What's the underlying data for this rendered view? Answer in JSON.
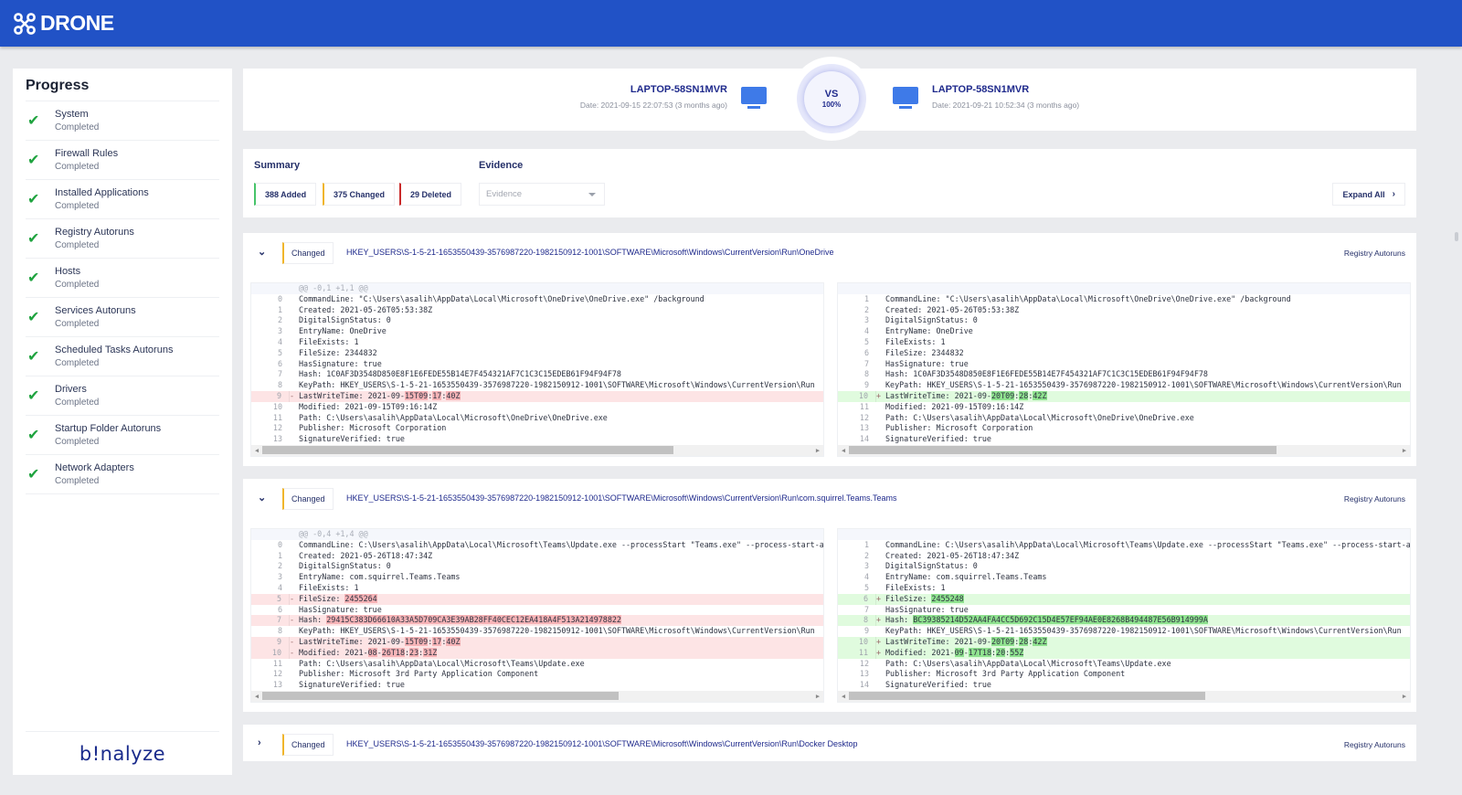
{
  "app": {
    "title": "DRONE",
    "brand_color": "#2152c6",
    "footer_brand": "b!nalyze"
  },
  "sidebar": {
    "title": "Progress",
    "items": [
      {
        "name": "System",
        "status": "Completed"
      },
      {
        "name": "Firewall Rules",
        "status": "Completed"
      },
      {
        "name": "Installed Applications",
        "status": "Completed"
      },
      {
        "name": "Registry Autoruns",
        "status": "Completed"
      },
      {
        "name": "Hosts",
        "status": "Completed"
      },
      {
        "name": "Services Autoruns",
        "status": "Completed"
      },
      {
        "name": "Scheduled Tasks Autoruns",
        "status": "Completed"
      },
      {
        "name": "Drivers",
        "status": "Completed"
      },
      {
        "name": "Startup Folder Autoruns",
        "status": "Completed"
      },
      {
        "name": "Network Adapters",
        "status": "Completed"
      }
    ]
  },
  "compare": {
    "left": {
      "host": "LAPTOP-58SN1MVR",
      "date": "Date: 2021-09-15 22:07:53 (3 months ago)"
    },
    "right": {
      "host": "LAPTOP-58SN1MVR",
      "date": "Date: 2021-09-21 10:52:34 (3 months ago)"
    },
    "vs_label": "VS",
    "similarity": "100%"
  },
  "summary": {
    "title": "Summary",
    "added": "388 Added",
    "changed": "375 Changed",
    "deleted": "29 Deleted",
    "evidence_title": "Evidence",
    "evidence_placeholder": "Evidence",
    "expand_all": "Expand All",
    "colors": {
      "added": "#47c46a",
      "changed": "#f0b52b",
      "deleted": "#c92a2a"
    }
  },
  "entries": [
    {
      "status": "Changed",
      "path": "HKEY_USERS\\S-1-5-21-1653550439-3576987220-1982150912-1001\\SOFTWARE\\Microsoft\\Windows\\CurrentVersion\\Run\\OneDrive",
      "category": "Registry Autoruns",
      "expanded": true,
      "left": [
        {
          "type": "hunk",
          "num": "",
          "text": "@@ -0,1 +1,1 @@"
        },
        {
          "type": "ctx",
          "num": "0",
          "text": "CommandLine: \"C:\\Users\\asalih\\AppData\\Local\\Microsoft\\OneDrive\\OneDrive.exe\" /background"
        },
        {
          "type": "ctx",
          "num": "1",
          "text": "Created: 2021-05-26T05:53:38Z"
        },
        {
          "type": "ctx",
          "num": "2",
          "text": "DigitalSignStatus: 0"
        },
        {
          "type": "ctx",
          "num": "3",
          "text": "EntryName: OneDrive"
        },
        {
          "type": "ctx",
          "num": "4",
          "text": "FileExists: 1"
        },
        {
          "type": "ctx",
          "num": "5",
          "text": "FileSize: 2344832"
        },
        {
          "type": "ctx",
          "num": "6",
          "text": "HasSignature: true"
        },
        {
          "type": "ctx",
          "num": "7",
          "text": "Hash: 1C0AF3D3548D850E8F1E6FEDE55B14E7F454321AF7C1C3C15EDEB61F94F94F78"
        },
        {
          "type": "ctx",
          "num": "8",
          "text": "KeyPath: HKEY_USERS\\S-1-5-21-1653550439-3576987220-1982150912-1001\\SOFTWARE\\Microsoft\\Windows\\CurrentVersion\\Run"
        },
        {
          "type": "del",
          "num": "9",
          "parts": [
            "LastWriteTime: 2021-09-",
            {
              "h": "15T09"
            },
            ":",
            {
              "h": "17"
            },
            ":",
            {
              "h": "40Z"
            }
          ]
        },
        {
          "type": "ctx",
          "num": "10",
          "text": "Modified: 2021-09-15T09:16:14Z"
        },
        {
          "type": "ctx",
          "num": "11",
          "text": "Path: C:\\Users\\asalih\\AppData\\Local\\Microsoft\\OneDrive\\OneDrive.exe"
        },
        {
          "type": "ctx",
          "num": "12",
          "text": "Publisher: Microsoft Corporation"
        },
        {
          "type": "ctx",
          "num": "13",
          "text": "SignatureVerified: true"
        }
      ],
      "right": [
        {
          "type": "hunk",
          "num": "",
          "text": ""
        },
        {
          "type": "ctx",
          "num": "1",
          "text": "CommandLine: \"C:\\Users\\asalih\\AppData\\Local\\Microsoft\\OneDrive\\OneDrive.exe\" /background"
        },
        {
          "type": "ctx",
          "num": "2",
          "text": "Created: 2021-05-26T05:53:38Z"
        },
        {
          "type": "ctx",
          "num": "3",
          "text": "DigitalSignStatus: 0"
        },
        {
          "type": "ctx",
          "num": "4",
          "text": "EntryName: OneDrive"
        },
        {
          "type": "ctx",
          "num": "5",
          "text": "FileExists: 1"
        },
        {
          "type": "ctx",
          "num": "6",
          "text": "FileSize: 2344832"
        },
        {
          "type": "ctx",
          "num": "7",
          "text": "HasSignature: true"
        },
        {
          "type": "ctx",
          "num": "8",
          "text": "Hash: 1C0AF3D3548D850E8F1E6FEDE55B14E7F454321AF7C1C3C15EDEB61F94F94F78"
        },
        {
          "type": "ctx",
          "num": "9",
          "text": "KeyPath: HKEY_USERS\\S-1-5-21-1653550439-3576987220-1982150912-1001\\SOFTWARE\\Microsoft\\Windows\\CurrentVersion\\Run"
        },
        {
          "type": "add",
          "num": "10",
          "parts": [
            "LastWriteTime: 2021-09-",
            {
              "h": "20T09"
            },
            ":",
            {
              "h": "28"
            },
            ":",
            {
              "h": "42Z"
            }
          ]
        },
        {
          "type": "ctx",
          "num": "11",
          "text": "Modified: 2021-09-15T09:16:14Z"
        },
        {
          "type": "ctx",
          "num": "12",
          "text": "Path: C:\\Users\\asalih\\AppData\\Local\\Microsoft\\OneDrive\\OneDrive.exe"
        },
        {
          "type": "ctx",
          "num": "13",
          "text": "Publisher: Microsoft Corporation"
        },
        {
          "type": "ctx",
          "num": "14",
          "text": "SignatureVerified: true"
        }
      ]
    },
    {
      "status": "Changed",
      "path": "HKEY_USERS\\S-1-5-21-1653550439-3576987220-1982150912-1001\\SOFTWARE\\Microsoft\\Windows\\CurrentVersion\\Run\\com.squirrel.Teams.Teams",
      "category": "Registry Autoruns",
      "expanded": true,
      "left": [
        {
          "type": "hunk",
          "num": "",
          "text": "@@ -0,4 +1,4 @@"
        },
        {
          "type": "ctx",
          "num": "0",
          "text": "CommandLine: C:\\Users\\asalih\\AppData\\Local\\Microsoft\\Teams\\Update.exe --processStart \"Teams.exe\" --process-start-args \"--system-initiated\""
        },
        {
          "type": "ctx",
          "num": "1",
          "text": "Created: 2021-05-26T18:47:34Z"
        },
        {
          "type": "ctx",
          "num": "2",
          "text": "DigitalSignStatus: 0"
        },
        {
          "type": "ctx",
          "num": "3",
          "text": "EntryName: com.squirrel.Teams.Teams"
        },
        {
          "type": "ctx",
          "num": "4",
          "text": "FileExists: 1"
        },
        {
          "type": "del",
          "num": "5",
          "parts": [
            "FileSize: ",
            {
              "h": "2455264"
            }
          ]
        },
        {
          "type": "ctx",
          "num": "6",
          "text": "HasSignature: true"
        },
        {
          "type": "del",
          "num": "7",
          "parts": [
            "Hash: ",
            {
              "h": "29415C383D66610A33A5D709CA3E39AB28FF40CEC12EA418A4F513A214978822"
            }
          ]
        },
        {
          "type": "ctx",
          "num": "8",
          "text": "KeyPath: HKEY_USERS\\S-1-5-21-1653550439-3576987220-1982150912-1001\\SOFTWARE\\Microsoft\\Windows\\CurrentVersion\\Run"
        },
        {
          "type": "del",
          "num": "9",
          "parts": [
            "LastWriteTime: 2021-09-",
            {
              "h": "15T09"
            },
            ":",
            {
              "h": "17"
            },
            ":",
            {
              "h": "40Z"
            }
          ]
        },
        {
          "type": "del",
          "num": "10",
          "parts": [
            "Modified: 2021-",
            {
              "h": "08"
            },
            "-",
            {
              "h": "26T18"
            },
            ":",
            {
              "h": "23"
            },
            ":",
            {
              "h": "31Z"
            }
          ]
        },
        {
          "type": "ctx",
          "num": "11",
          "text": "Path: C:\\Users\\asalih\\AppData\\Local\\Microsoft\\Teams\\Update.exe"
        },
        {
          "type": "ctx",
          "num": "12",
          "text": "Publisher: Microsoft 3rd Party Application Component"
        },
        {
          "type": "ctx",
          "num": "13",
          "text": "SignatureVerified: true"
        }
      ],
      "right": [
        {
          "type": "hunk",
          "num": "",
          "text": ""
        },
        {
          "type": "ctx",
          "num": "1",
          "text": "CommandLine: C:\\Users\\asalih\\AppData\\Local\\Microsoft\\Teams\\Update.exe --processStart \"Teams.exe\" --process-start-args \"--system-initiated\""
        },
        {
          "type": "ctx",
          "num": "2",
          "text": "Created: 2021-05-26T18:47:34Z"
        },
        {
          "type": "ctx",
          "num": "3",
          "text": "DigitalSignStatus: 0"
        },
        {
          "type": "ctx",
          "num": "4",
          "text": "EntryName: com.squirrel.Teams.Teams"
        },
        {
          "type": "ctx",
          "num": "5",
          "text": "FileExists: 1"
        },
        {
          "type": "add",
          "num": "6",
          "parts": [
            "FileSize: ",
            {
              "h": "2455248"
            }
          ]
        },
        {
          "type": "ctx",
          "num": "7",
          "text": "HasSignature: true"
        },
        {
          "type": "add",
          "num": "8",
          "parts": [
            "Hash: ",
            {
              "h": "BC39385214D52AA4FA4CC5D692C15D4E57EF94AE0E8268B494487E56B914999A"
            }
          ]
        },
        {
          "type": "ctx",
          "num": "9",
          "text": "KeyPath: HKEY_USERS\\S-1-5-21-1653550439-3576987220-1982150912-1001\\SOFTWARE\\Microsoft\\Windows\\CurrentVersion\\Run"
        },
        {
          "type": "add",
          "num": "10",
          "parts": [
            "LastWriteTime: 2021-09-",
            {
              "h": "20T09"
            },
            ":",
            {
              "h": "28"
            },
            ":",
            {
              "h": "42Z"
            }
          ]
        },
        {
          "type": "add",
          "num": "11",
          "parts": [
            "Modified: 2021-",
            {
              "h": "09"
            },
            "-",
            {
              "h": "17T18"
            },
            ":",
            {
              "h": "20"
            },
            ":",
            {
              "h": "55Z"
            }
          ]
        },
        {
          "type": "ctx",
          "num": "12",
          "text": "Path: C:\\Users\\asalih\\AppData\\Local\\Microsoft\\Teams\\Update.exe"
        },
        {
          "type": "ctx",
          "num": "13",
          "text": "Publisher: Microsoft 3rd Party Application Component"
        },
        {
          "type": "ctx",
          "num": "14",
          "text": "SignatureVerified: true"
        }
      ]
    },
    {
      "status": "Changed",
      "path": "HKEY_USERS\\S-1-5-21-1653550439-3576987220-1982150912-1001\\SOFTWARE\\Microsoft\\Windows\\CurrentVersion\\Run\\Docker Desktop",
      "category": "Registry Autoruns",
      "expanded": false
    }
  ]
}
